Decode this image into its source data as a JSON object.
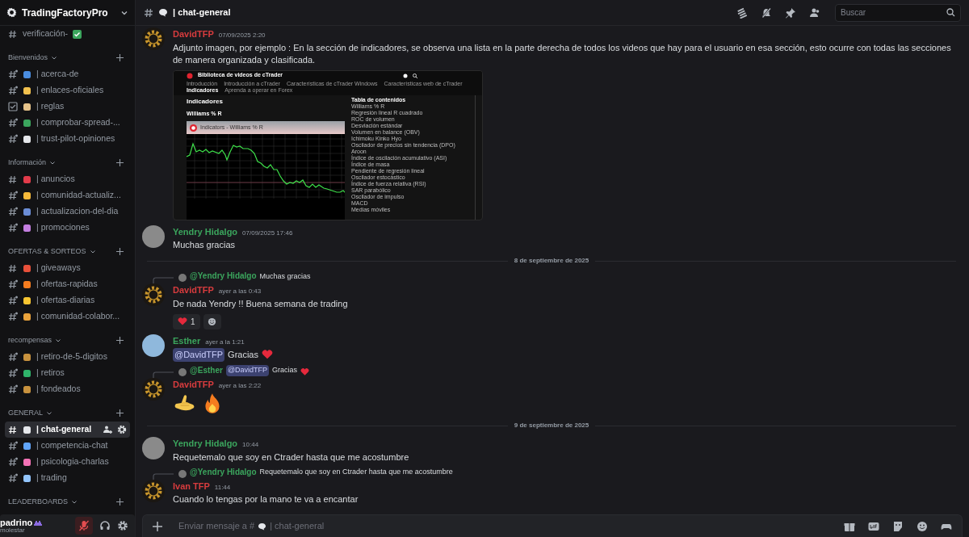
{
  "server": {
    "name": "TradingFactoryPro"
  },
  "channel_list": [
    {
      "kind": "channel",
      "name": "verificación-",
      "trailing_check": true,
      "selected": false
    },
    {
      "kind": "category",
      "label": "Bienvenidos"
    },
    {
      "kind": "private_channel",
      "name": "| acerca-de",
      "selected": false
    },
    {
      "kind": "private_channel",
      "name": "| enlaces-oficiales",
      "selected": false
    },
    {
      "kind": "rules_channel",
      "name": "| reglas",
      "selected": false
    },
    {
      "kind": "private_channel",
      "name": "| comprobar-spread-...",
      "selected": false
    },
    {
      "kind": "private_channel",
      "name": "| trust-pilot-opiniones",
      "selected": false
    },
    {
      "kind": "category",
      "label": "Información"
    },
    {
      "kind": "channel",
      "name": "| anuncios",
      "selected": false
    },
    {
      "kind": "private_channel",
      "name": "| comunidad-actualiz...",
      "selected": false
    },
    {
      "kind": "private_channel",
      "name": "| actualizacion-del-dia",
      "selected": false
    },
    {
      "kind": "private_channel",
      "name": "| promociones",
      "selected": false
    },
    {
      "kind": "category",
      "label": "OFERTAS & SORTEOS"
    },
    {
      "kind": "channel",
      "name": "| giveaways",
      "selected": false
    },
    {
      "kind": "private_channel",
      "name": "| ofertas-rapidas",
      "selected": false
    },
    {
      "kind": "private_channel",
      "name": "| ofertas-diarias",
      "selected": false
    },
    {
      "kind": "private_channel",
      "name": "| comunidad-colabor...",
      "selected": false
    },
    {
      "kind": "category",
      "label": "recompensas"
    },
    {
      "kind": "private_channel",
      "name": "| retiro-de-5-digitos",
      "selected": false
    },
    {
      "kind": "private_channel",
      "name": "| retiros",
      "selected": false
    },
    {
      "kind": "private_channel",
      "name": "| fondeados",
      "selected": false
    },
    {
      "kind": "category",
      "label": "GENERAL"
    },
    {
      "kind": "channel",
      "name": "| chat-general",
      "selected": true
    },
    {
      "kind": "private_channel",
      "name": "| competencia-chat",
      "selected": false
    },
    {
      "kind": "private_channel",
      "name": "| psicologia-charlas",
      "selected": false
    },
    {
      "kind": "private_channel",
      "name": "| trading",
      "selected": false
    },
    {
      "kind": "category",
      "label": "LEADERBOARDS"
    }
  ],
  "user_panel": {
    "name": "padrino",
    "status": "molestar",
    "mic_muted": true
  },
  "header": {
    "channel": "| chat-general",
    "search_placeholder": "Buscar"
  },
  "messages": [
    {
      "kind": "message",
      "author": "DavidTFP",
      "color": "#d83c3e",
      "avatar": {
        "kind": "logo"
      },
      "time": "07/09/2025 2:20",
      "segments": [
        {
          "kind": "text",
          "text": "Adjunto imagen, por ejemplo : En la sección de indicadores, se observa una lista en la parte derecha de todos los videos que hay para el usuario en esa sección, esto ocurre con todas las secciones de manera organizada y clasificada."
        }
      ],
      "attachment": {
        "site_title": "Biblioteca de videos de cTrader",
        "nav": [
          {
            "label": "Introducción",
            "selected": false
          },
          {
            "label": "Introducción a cTrader",
            "selected": false
          },
          {
            "label": "Características de cTrader Windows",
            "selected": false
          },
          {
            "label": "Características web de cTrader",
            "selected": false
          },
          {
            "label": "Indicadores",
            "selected": true
          },
          {
            "label": "Aprenda a operar en Forex",
            "selected": false
          }
        ],
        "heading": "Indicadores",
        "subheading": "Williams % R",
        "video_title": "Indicators - Williams % R",
        "toc_title": "Tabla de contenidos",
        "toc": [
          "Williams % R",
          "Regresión lineal R cuadrado",
          "ROC de volumen",
          "Desviación estándar",
          "Volumen en balance (OBV)",
          "Ichimoku Kinko Hyo",
          "Oscilador de precios sin tendencia (DPO)",
          "Aroon",
          "Índice de oscilación acumulativo (ASI)",
          "Índice de masa",
          "Pendiente de regresión lineal",
          "Oscilador estocástico",
          "Índice de fuerza relativa (RSI)",
          "SAR parabólico",
          "Oscilador de impulso",
          "MACD",
          "Medias móviles"
        ]
      }
    },
    {
      "kind": "message",
      "author": "Yendry Hidalgo",
      "color": "#3ba55d",
      "avatar": {
        "kind": "photo",
        "color": "#8a8a8a"
      },
      "time": "07/09/2025 17:46",
      "segments": [
        {
          "kind": "text",
          "text": "Muchas gracias"
        }
      ]
    },
    {
      "kind": "divider",
      "label": "8 de septiembre de 2025"
    },
    {
      "kind": "message",
      "reply": {
        "author": "@Yendry Hidalgo",
        "color": "#3ba55d",
        "segments": [
          {
            "kind": "text",
            "text": "Muchas gracias"
          }
        ]
      },
      "author": "DavidTFP",
      "color": "#d83c3e",
      "avatar": {
        "kind": "logo"
      },
      "time": "ayer a las 0:43",
      "segments": [
        {
          "kind": "text",
          "text": "De nada Yendry !! Buena semana de trading"
        }
      ],
      "reactions": [
        {
          "count": "1",
          "selected": false
        }
      ]
    },
    {
      "kind": "message",
      "author": "Esther",
      "color": "#3ba55d",
      "avatar": {
        "kind": "photo",
        "color": "#8fb8dc"
      },
      "time": "ayer a la 1:21",
      "segments": [
        {
          "kind": "mention",
          "text": "@DavidTFP"
        },
        {
          "kind": "text",
          "text": "Gracias"
        },
        {
          "kind": "heart"
        }
      ]
    },
    {
      "kind": "message",
      "reply": {
        "author": "@Esther",
        "color": "#3ba55d",
        "segments": [
          {
            "kind": "mention",
            "text": "@DavidTFP"
          },
          {
            "kind": "text",
            "text": "Gracias"
          },
          {
            "kind": "heart"
          }
        ]
      },
      "author": "DavidTFP",
      "color": "#d83c3e",
      "avatar": {
        "kind": "logo"
      },
      "time": "ayer a las 2:22",
      "segments": [
        {
          "kind": "jumbo_emoji"
        },
        {
          "kind": "jumbo_emoji"
        }
      ]
    },
    {
      "kind": "divider",
      "label": "9 de septiembre de 2025"
    },
    {
      "kind": "message",
      "author": "Yendry Hidalgo",
      "color": "#3ba55d",
      "avatar": {
        "kind": "photo",
        "color": "#8a8a8a"
      },
      "time": "10:44",
      "segments": [
        {
          "kind": "text",
          "text": "Requetemalo que soy en Ctrader hasta que me acostumbre"
        }
      ]
    },
    {
      "kind": "message",
      "reply": {
        "author": "@Yendry Hidalgo",
        "color": "#3ba55d",
        "segments": [
          {
            "kind": "text",
            "text": "Requetemalo que soy en Ctrader hasta que me acostumbre"
          }
        ]
      },
      "author": "Ivan TFP",
      "color": "#d83c3e",
      "avatar": {
        "kind": "logo"
      },
      "time": "11:44",
      "segments": [
        {
          "kind": "text",
          "text": "Cuando lo tengas por la mano te va a encantar"
        }
      ]
    }
  ],
  "composer": {
    "placeholder": {
      "before_icon": "Enviar mensaje a #",
      "after_icon": "| chat-general"
    }
  }
}
